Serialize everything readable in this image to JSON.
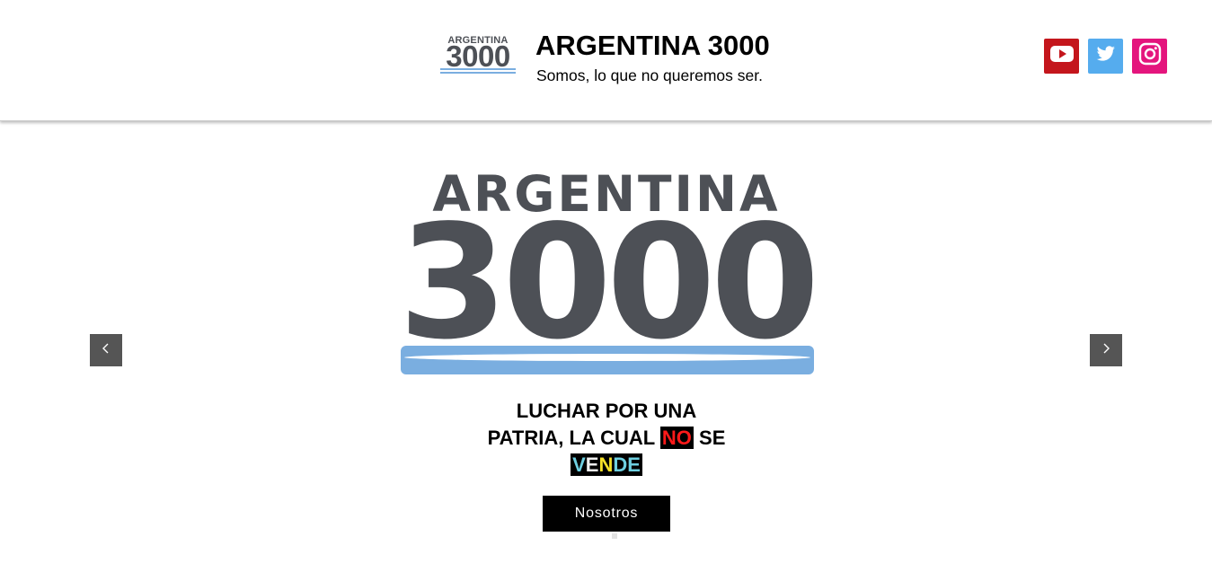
{
  "header": {
    "logo_word": "ARGENTINA",
    "logo_number": "3000",
    "title": "ARGENTINA 3000",
    "tagline": "Somos, lo que no queremos ser."
  },
  "social": [
    {
      "name": "youtube",
      "icon": "youtube-icon",
      "color": "#c4161c"
    },
    {
      "name": "twitter",
      "icon": "twitter-icon",
      "color": "#55acee"
    },
    {
      "name": "instagram",
      "icon": "instagram-icon",
      "color": "#e4157d"
    }
  ],
  "hero": {
    "logo_word": "ARGENTINA",
    "logo_number": "3000",
    "slogan_line1": "LUCHAR POR UNA",
    "slogan_line2_a": "PATRIA, LA CUAL",
    "slogan_no": "NO",
    "slogan_line2_b": "SE",
    "slogan_vende_letters": [
      "V",
      "E",
      "N",
      "D",
      "E"
    ],
    "slogan_vende_colors": [
      "#6ecfe0",
      "#f0f0f0",
      "#f5e028",
      "#6ecfe0",
      "#6ecfe0"
    ],
    "button_label": "Nosotros",
    "prev_icon": "chevron-left-icon",
    "next_icon": "chevron-right-icon"
  },
  "colors": {
    "logo_gray": "#4d5056",
    "logo_blue": "#7aaee0",
    "arrow_bg": "#555555"
  }
}
